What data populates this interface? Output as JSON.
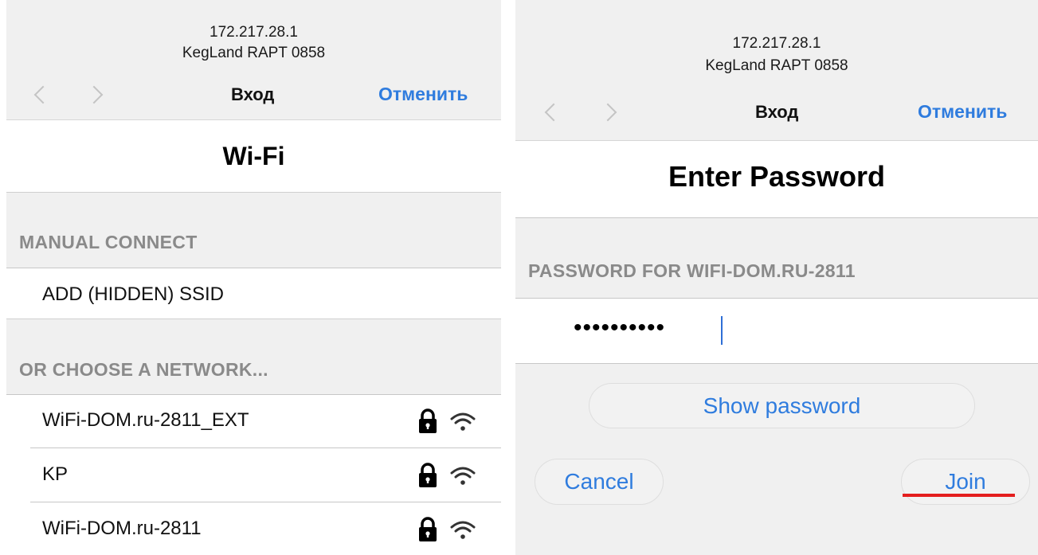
{
  "left": {
    "address": "172.217.28.1",
    "host": "KegLand RAPT 0858",
    "nav_title": "Вход",
    "cancel_label": "Отменить",
    "page_title": "Wi-Fi",
    "manual_header": "MANUAL CONNECT",
    "add_ssid": "ADD (HIDDEN) SSID",
    "choose_header": "OR CHOOSE A NETWORK...",
    "networks": [
      {
        "name": "WiFi-DOM.ru-2811_EXT",
        "lock_icon": "lock-icon",
        "signal_icon": "wifi-icon"
      },
      {
        "name": "KP",
        "lock_icon": "lock-icon",
        "signal_icon": "wifi-icon"
      },
      {
        "name": "WiFi-DOM.ru-2811",
        "lock_icon": "lock-icon",
        "signal_icon": "wifi-icon"
      }
    ]
  },
  "right": {
    "address": "172.217.28.1",
    "host": "KegLand RAPT 0858",
    "nav_title": "Вход",
    "cancel_label": "Отменить",
    "page_title": "Enter Password",
    "password_header": "PASSWORD FOR WIFI-DOM.RU-2811",
    "password_value": "••••••••••",
    "show_password_label": "Show password",
    "cancel_button_label": "Cancel",
    "join_button_label": "Join"
  },
  "colors": {
    "accent": "#2f7cde",
    "annotation_underline": "#e41e1e",
    "background_gray": "#f0f0f0",
    "section_text": "#8a8a8a"
  }
}
